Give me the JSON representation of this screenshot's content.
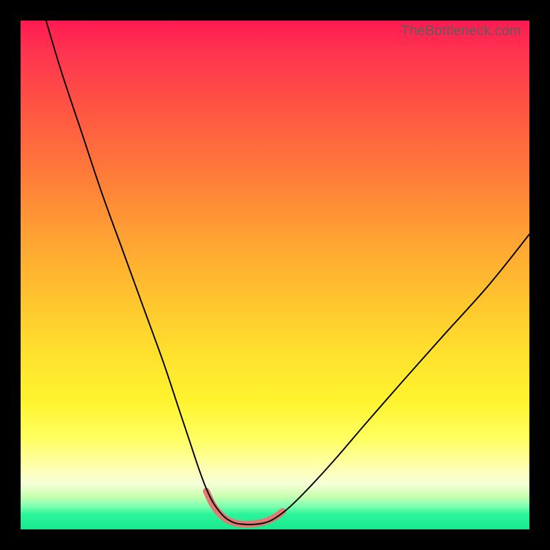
{
  "watermark": "TheBottleneck.com",
  "chart_data": {
    "type": "line",
    "title": "",
    "xlabel": "",
    "ylabel": "",
    "xlim": [
      0,
      100
    ],
    "ylim": [
      0,
      100
    ],
    "grid": false,
    "legend": false,
    "series": [
      {
        "name": "main-curve",
        "color": "#000000",
        "stroke_width": 2,
        "x": [
          5,
          8,
          12,
          16,
          20,
          24,
          28,
          31,
          33,
          35,
          36.5,
          38,
          40,
          42,
          44,
          46,
          48,
          50,
          53,
          57,
          62,
          68,
          75,
          83,
          92,
          100
        ],
        "y": [
          100,
          90,
          78,
          66,
          55,
          44,
          33,
          24,
          18,
          12,
          8,
          5,
          2.5,
          1.3,
          1.0,
          1.0,
          1.3,
          2.2,
          4.5,
          8.5,
          14,
          21,
          29,
          38,
          48,
          58
        ]
      },
      {
        "name": "highlight-flat-segment",
        "color": "#e27a74",
        "stroke_width": 10,
        "x": [
          36.5,
          38,
          40,
          42,
          44,
          46,
          48,
          50,
          51.5
        ],
        "y": [
          7.5,
          4.5,
          2.3,
          1.3,
          1.0,
          1.1,
          1.5,
          2.4,
          3.5
        ]
      }
    ],
    "annotations": []
  }
}
